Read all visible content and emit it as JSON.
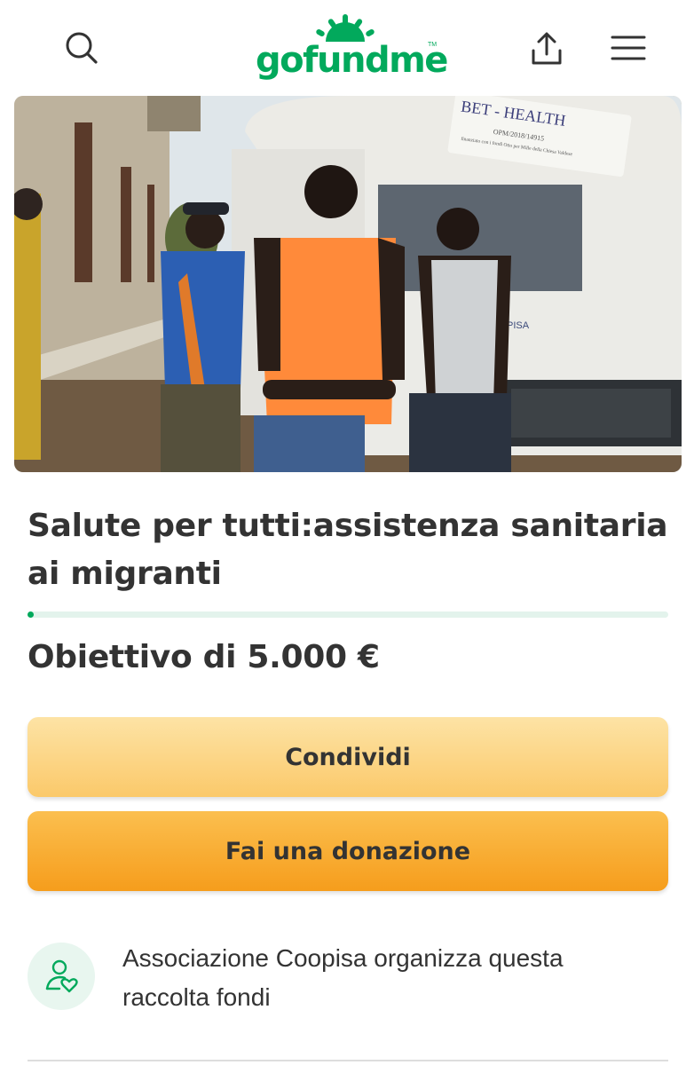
{
  "header": {
    "logo_text": "gofundme",
    "logo_tm": "TM",
    "icons": [
      "search-icon",
      "share-icon",
      "menu-icon"
    ],
    "brand_color": "#02a95c"
  },
  "hero": {
    "sign_title": "BET - HEALTH",
    "sign_line1": "OPM/2018/14915",
    "sign_line2": "finanziato con i fondi Otto per Mille della Chiesa Valdese",
    "decal": "PISA"
  },
  "campaign": {
    "title": "Salute per tutti:assistenza sanitaria ai migranti",
    "progress_fraction": 0.0,
    "goal": "Obiettivo di 5.000 €"
  },
  "actions": {
    "share_label": "Condividi",
    "donate_label": "Fai una donazione"
  },
  "organizer": {
    "icon": "organizer-heart-icon",
    "text": "Associazione Coopisa organizza questa raccolta fondi"
  },
  "colors": {
    "share_button": "#fbd386",
    "donate_button": "#f8a928",
    "progress_track": "#e3f3ec"
  }
}
